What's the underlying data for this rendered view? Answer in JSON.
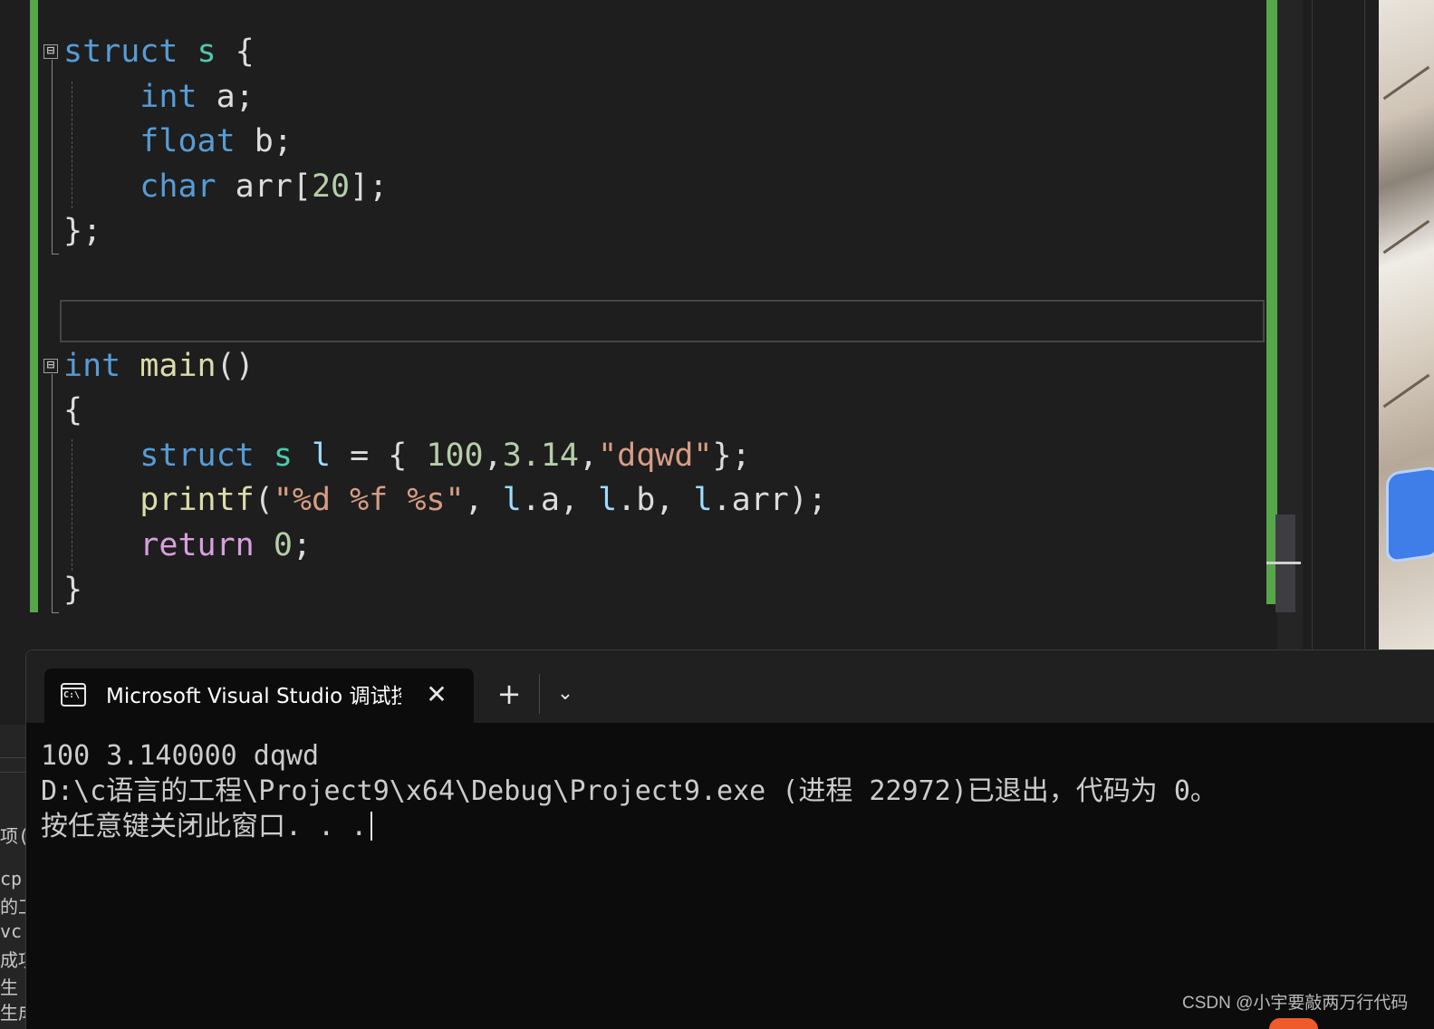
{
  "editor": {
    "lines": [
      [
        [
          "kw",
          "struct"
        ],
        [
          "pl",
          " "
        ],
        [
          "ty",
          "s"
        ],
        [
          "pl",
          " {"
        ]
      ],
      [
        [
          "pl",
          "    "
        ],
        [
          "kw",
          "int"
        ],
        [
          "pl",
          " a;"
        ]
      ],
      [
        [
          "pl",
          "    "
        ],
        [
          "kw",
          "float"
        ],
        [
          "pl",
          " b;"
        ]
      ],
      [
        [
          "pl",
          "    "
        ],
        [
          "kw",
          "char"
        ],
        [
          "pl",
          " arr["
        ],
        [
          "num",
          "20"
        ],
        [
          "pl",
          "];"
        ]
      ],
      [
        [
          "pl",
          "};"
        ]
      ],
      [],
      [],
      [
        [
          "kw",
          "int"
        ],
        [
          "pl",
          " "
        ],
        [
          "fn",
          "main"
        ],
        [
          "pl",
          "()"
        ]
      ],
      [
        [
          "pl",
          "{"
        ]
      ],
      [
        [
          "pl",
          "    "
        ],
        [
          "kw",
          "struct"
        ],
        [
          "pl",
          " "
        ],
        [
          "ty",
          "s"
        ],
        [
          "pl",
          " "
        ],
        [
          "var",
          "l"
        ],
        [
          "pl",
          " = { "
        ],
        [
          "num",
          "100"
        ],
        [
          "pl",
          ","
        ],
        [
          "num",
          "3.14"
        ],
        [
          "pl",
          ","
        ],
        [
          "str",
          "\"dqwd\""
        ],
        [
          "pl",
          "};"
        ]
      ],
      [
        [
          "pl",
          "    "
        ],
        [
          "fn",
          "printf"
        ],
        [
          "pl",
          "("
        ],
        [
          "str",
          "\"%d %f %s\""
        ],
        [
          "pl",
          ", "
        ],
        [
          "var",
          "l"
        ],
        [
          "pl",
          ".a, "
        ],
        [
          "var",
          "l"
        ],
        [
          "pl",
          ".b, "
        ],
        [
          "var",
          "l"
        ],
        [
          "pl",
          ".arr);"
        ]
      ],
      [
        [
          "pl",
          "    "
        ],
        [
          "ctl",
          "return"
        ],
        [
          "pl",
          " "
        ],
        [
          "num",
          "0"
        ],
        [
          "pl",
          ";"
        ]
      ],
      [
        [
          "pl",
          "}"
        ]
      ]
    ],
    "fold_glyph": "⊟"
  },
  "terminal": {
    "tab": {
      "icon_text": "C:\\",
      "title": "Microsoft Visual Studio 调试控制台",
      "close_glyph": "✕",
      "add_glyph": "+",
      "dropdown_glyph": "⌄"
    },
    "output": [
      "100 3.140000 dqwd",
      "D:\\c语言的工程\\Project9\\x64\\Debug\\Project9.exe (进程 22972)已退出，代码为 0。",
      "按任意键关闭此窗口. . ."
    ]
  },
  "left_panel": {
    "rows": [
      "项(S",
      "cp",
      "的工",
      "vc",
      "成项",
      "生",
      "生成"
    ]
  },
  "watermark": "CSDN @小宇要敲两万行代码",
  "colors": {
    "keyword": "#569cd6",
    "type": "#4ec9b0",
    "function": "#dcdcaa",
    "variable": "#9cdcfe",
    "number": "#b5cea8",
    "string": "#d69d85",
    "control": "#d8a0df",
    "change_bar": "#57a64a"
  }
}
